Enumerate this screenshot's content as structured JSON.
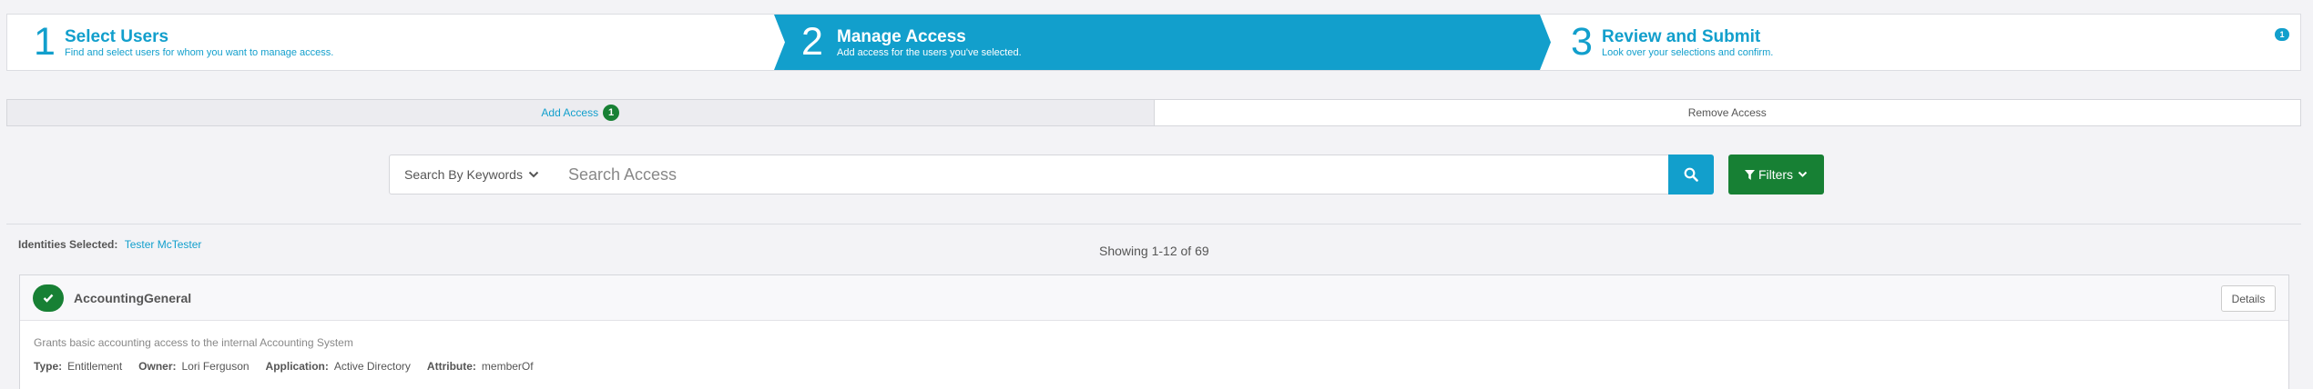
{
  "wizard": {
    "steps": [
      {
        "number": "1",
        "title": "Select Users",
        "subtitle": "Find and select users for whom you want to manage access."
      },
      {
        "number": "2",
        "title": "Manage Access",
        "subtitle": "Add access for the users you've selected."
      },
      {
        "number": "3",
        "title": "Review and Submit",
        "subtitle": "Look over your selections and confirm."
      }
    ],
    "active_step": 2,
    "badge": "1",
    "colors": {
      "active": "#129fcc",
      "text": "#129fcc"
    }
  },
  "tabs": {
    "add_label": "Add Access",
    "add_count": "1",
    "remove_label": "Remove Access"
  },
  "search": {
    "type_label": "Search By Keywords",
    "placeholder": "Search Access",
    "value": "",
    "search_icon": "search-icon",
    "filters_label": "Filters",
    "filter_icon": "funnel-icon"
  },
  "identities": {
    "label": "Identities Selected:",
    "value": "Tester McTester"
  },
  "results": {
    "showing": "Showing 1-12 of 69"
  },
  "items": [
    {
      "name": "AccountingGeneral",
      "selected": true,
      "details_label": "Details",
      "description": "Grants basic accounting access to the internal Accounting System",
      "meta": [
        {
          "key": "Type:",
          "value": "Entitlement"
        },
        {
          "key": "Owner:",
          "value": "Lori Ferguson"
        },
        {
          "key": "Application:",
          "value": "Active Directory"
        },
        {
          "key": "Attribute:",
          "value": "memberOf"
        }
      ]
    }
  ],
  "colors": {
    "primary": "#129fcc",
    "success": "#178034",
    "background": "#f3f3f6"
  }
}
